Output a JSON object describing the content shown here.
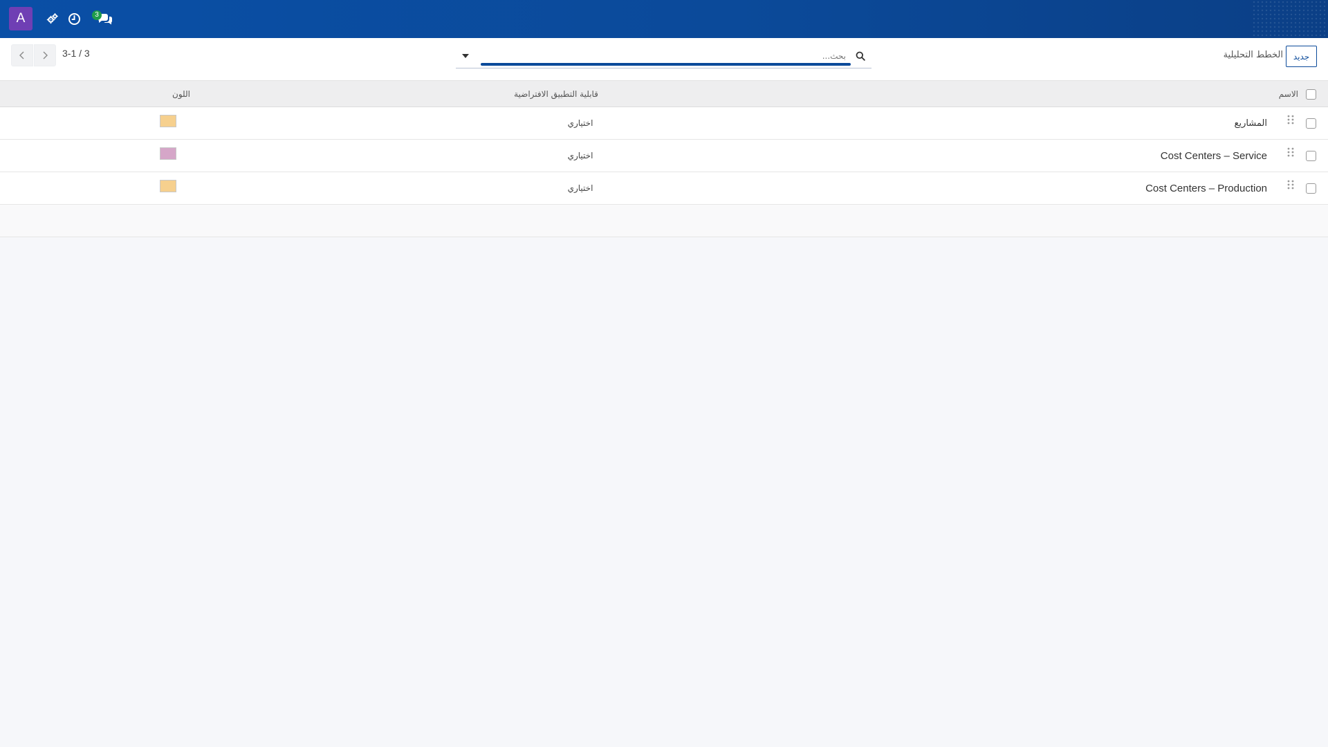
{
  "navbar": {
    "avatar_letter": "A",
    "icons": [
      "settings-gears-icon",
      "clock-icon",
      "chat-bubbles-icon"
    ],
    "chat_badge_count": "3"
  },
  "control_panel": {
    "pager_value": "3-1 / 3",
    "search_placeholder": "بحث...",
    "breadcrumb_title": "الخطط التحليلية",
    "new_button_label": "جديد"
  },
  "table": {
    "headers": {
      "name": "الاسم",
      "default_applicability": "قابلية التطبيق الافتراضية",
      "color": "اللون"
    },
    "rows": [
      {
        "name": "المشاريع",
        "applicability": "اختياري",
        "color": "#f6d08e"
      },
      {
        "name": "Cost Centers – Service",
        "applicability": "اختياري",
        "color": "#d5a6c8"
      },
      {
        "name": "Cost Centers – Production",
        "applicability": "اختياري",
        "color": "#f6d08e"
      }
    ]
  },
  "colors": {
    "navbar": "#0b4a9a",
    "avatar": "#6f3fb4",
    "badge": "#1f9c4a"
  }
}
